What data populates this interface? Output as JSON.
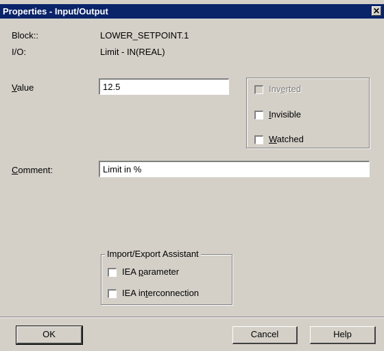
{
  "window": {
    "title": "Properties - Input/Output",
    "close_glyph": "✕"
  },
  "info": {
    "block_label": "Block::",
    "block_value": "LOWER_SETPOINT.1",
    "io_label": "I/O:",
    "io_value": "Limit  -  IN(REAL)"
  },
  "value": {
    "label_ul": "V",
    "label_rest": "alue",
    "text": "12.5"
  },
  "options": {
    "inverted": {
      "pre": "Inv",
      "ul": "e",
      "post": "rted",
      "checked": false,
      "disabled": true
    },
    "invisible": {
      "pre": "",
      "ul": "I",
      "post": "nvisible",
      "checked": false
    },
    "watched": {
      "pre": "",
      "ul": "W",
      "post": "atched",
      "checked": false
    }
  },
  "comment": {
    "label_ul": "C",
    "label_rest": "omment:",
    "text": "Limit in %"
  },
  "assistant": {
    "title": "Import/Export Assistant",
    "iea_parameter": {
      "pre": "IEA ",
      "ul": "p",
      "post": "arameter",
      "checked": false
    },
    "iea_interconnection": {
      "pre": "IEA in",
      "ul": "t",
      "post": "erconnection",
      "checked": false
    }
  },
  "buttons": {
    "ok": "OK",
    "cancel": "Cancel",
    "help": "Help"
  }
}
